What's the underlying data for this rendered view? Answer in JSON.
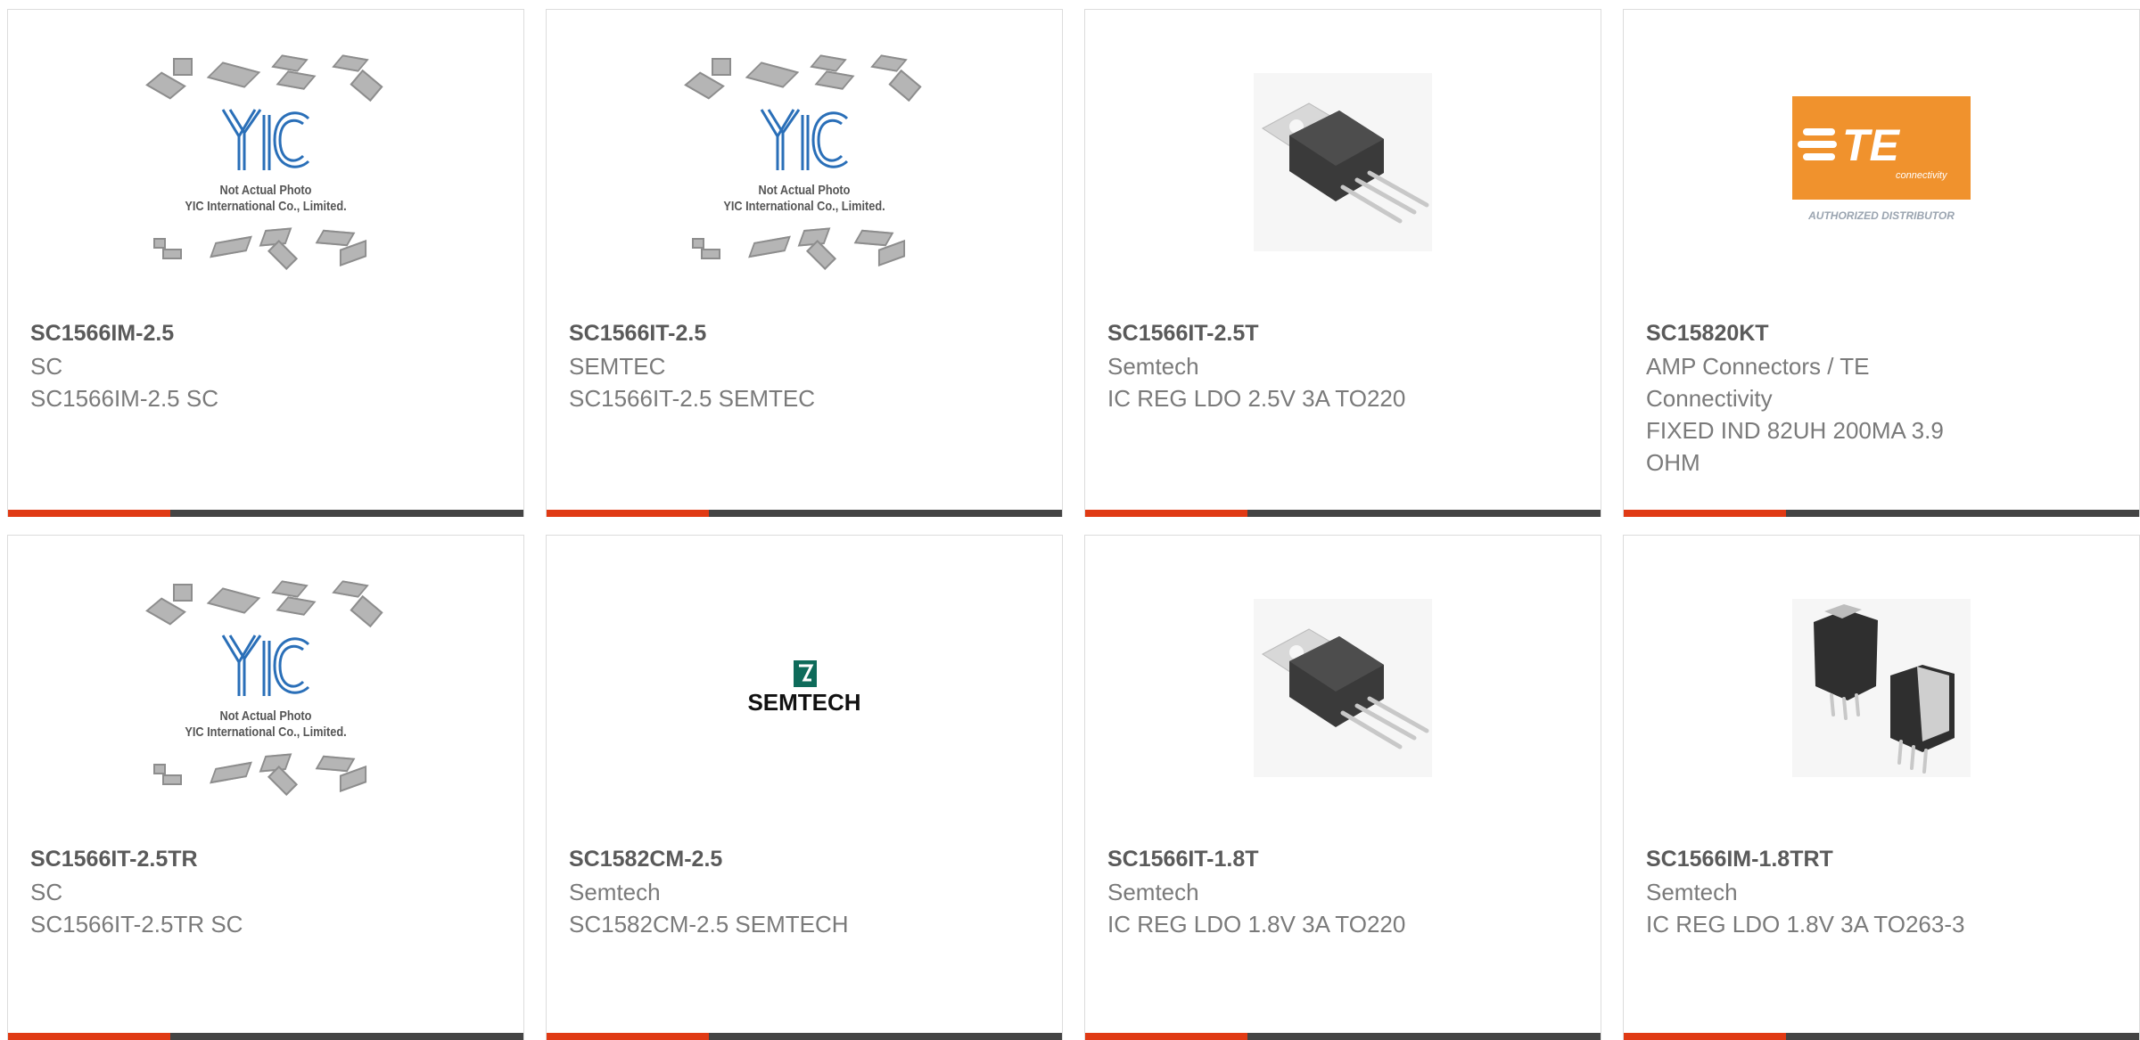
{
  "products": [
    {
      "part": "SC1566IM-2.5",
      "manufacturer": "SC",
      "description": "SC1566IM-2.5 SC",
      "image": "not-actual-photo",
      "photo_caption": [
        "Not Actual Photo",
        "YIC International Co., Limited."
      ],
      "logo_text": "YIC"
    },
    {
      "part": "SC1566IT-2.5",
      "manufacturer": "SEMTEC",
      "description": "SC1566IT-2.5 SEMTEC",
      "image": "not-actual-photo",
      "photo_caption": [
        "Not Actual Photo",
        "YIC International Co., Limited."
      ],
      "logo_text": "YIC"
    },
    {
      "part": "SC1566IT-2.5T",
      "manufacturer": "Semtech",
      "description": "IC REG LDO 2.5V 3A TO220",
      "image": "to220-package"
    },
    {
      "part": "SC15820KT",
      "manufacturer": "AMP Connectors / TE Connectivity",
      "description": "FIXED IND 82UH 200MA 3.9 OHM",
      "image": "te-connectivity-logo",
      "logo_text": "TE",
      "logo_subtext": "connectivity",
      "logo_caption": "AUTHORIZED DISTRIBUTOR"
    },
    {
      "part": "SC1566IT-2.5TR",
      "manufacturer": "SC",
      "description": "SC1566IT-2.5TR SC",
      "image": "not-actual-photo",
      "photo_caption": [
        "Not Actual Photo",
        "YIC International Co., Limited."
      ],
      "logo_text": "YIC"
    },
    {
      "part": "SC1582CM-2.5",
      "manufacturer": "Semtech",
      "description": "SC1582CM-2.5 SEMTECH",
      "image": "semtech-logo",
      "logo_text": "SEMTECH"
    },
    {
      "part": "SC1566IT-1.8T",
      "manufacturer": "Semtech",
      "description": "IC REG LDO 1.8V 3A TO220",
      "image": "to220-package"
    },
    {
      "part": "SC1566IM-1.8TRT",
      "manufacturer": "Semtech",
      "description": "IC REG LDO 1.8V 3A TO263-3",
      "image": "d2pak-package"
    }
  ],
  "colors": {
    "accent": "#e03a14",
    "bar": "#444444",
    "part_text": "#5a5a5a",
    "meta_text": "#7a7a7a",
    "yic_blue": "#2a6fb8",
    "te_orange": "#f0922d",
    "semtech_teal": "#0e6b5a"
  }
}
